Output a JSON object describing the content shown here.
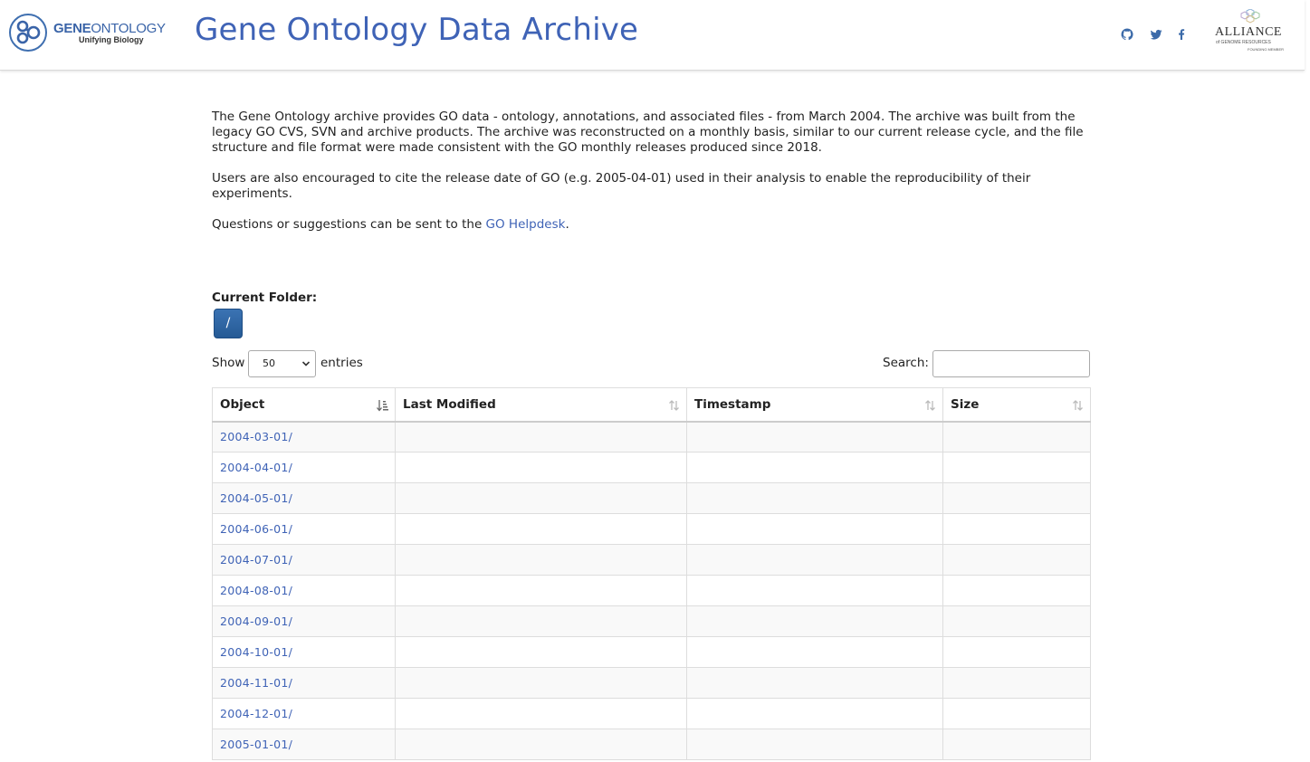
{
  "header": {
    "logo_gene": "GENE",
    "logo_ontology": "ONTOLOGY",
    "logo_tagline": "Unifying Biology",
    "title": "Gene Ontology Data Archive",
    "social_icons": [
      "github-icon",
      "twitter-icon",
      "facebook-icon"
    ],
    "alliance_name": "ALLIANCE",
    "alliance_sub": "of GENOME RESOURCES",
    "alliance_founding": "FOUNDING MEMBER"
  },
  "intro": {
    "p1": "The Gene Ontology archive provides GO data - ontology, annotations, and associated files - from March 2004. The archive was built from the legacy GO CVS, SVN and archive products. The archive was reconstructed on a monthly basis, similar to our current release cycle, and the file structure and file format were made consistent with the GO monthly releases produced since 2018.",
    "p2": "Users are also encouraged to cite the release date of GO (e.g. 2005-04-01) used in their analysis to enable the reproducibility of their experiments.",
    "p3_prefix": "Questions or suggestions can be sent to the ",
    "p3_link": "GO Helpdesk",
    "p3_suffix": "."
  },
  "folder": {
    "label": "Current Folder:",
    "button": "/"
  },
  "controls": {
    "show_label": "Show",
    "entries_value": "50",
    "entries_label": "entries",
    "search_label": "Search:",
    "search_value": ""
  },
  "table": {
    "columns": [
      "Object",
      "Last Modified",
      "Timestamp",
      "Size"
    ],
    "rows": [
      {
        "object": "2004-03-01/",
        "last_modified": "",
        "timestamp": "",
        "size": ""
      },
      {
        "object": "2004-04-01/",
        "last_modified": "",
        "timestamp": "",
        "size": ""
      },
      {
        "object": "2004-05-01/",
        "last_modified": "",
        "timestamp": "",
        "size": ""
      },
      {
        "object": "2004-06-01/",
        "last_modified": "",
        "timestamp": "",
        "size": ""
      },
      {
        "object": "2004-07-01/",
        "last_modified": "",
        "timestamp": "",
        "size": ""
      },
      {
        "object": "2004-08-01/",
        "last_modified": "",
        "timestamp": "",
        "size": ""
      },
      {
        "object": "2004-09-01/",
        "last_modified": "",
        "timestamp": "",
        "size": ""
      },
      {
        "object": "2004-10-01/",
        "last_modified": "",
        "timestamp": "",
        "size": ""
      },
      {
        "object": "2004-11-01/",
        "last_modified": "",
        "timestamp": "",
        "size": ""
      },
      {
        "object": "2004-12-01/",
        "last_modified": "",
        "timestamp": "",
        "size": ""
      },
      {
        "object": "2005-01-01/",
        "last_modified": "",
        "timestamp": "",
        "size": ""
      }
    ]
  },
  "colors": {
    "brand_blue": "#3f63b6",
    "button_blue": "#2b639f",
    "row_stripe": "#f9f9f9"
  }
}
